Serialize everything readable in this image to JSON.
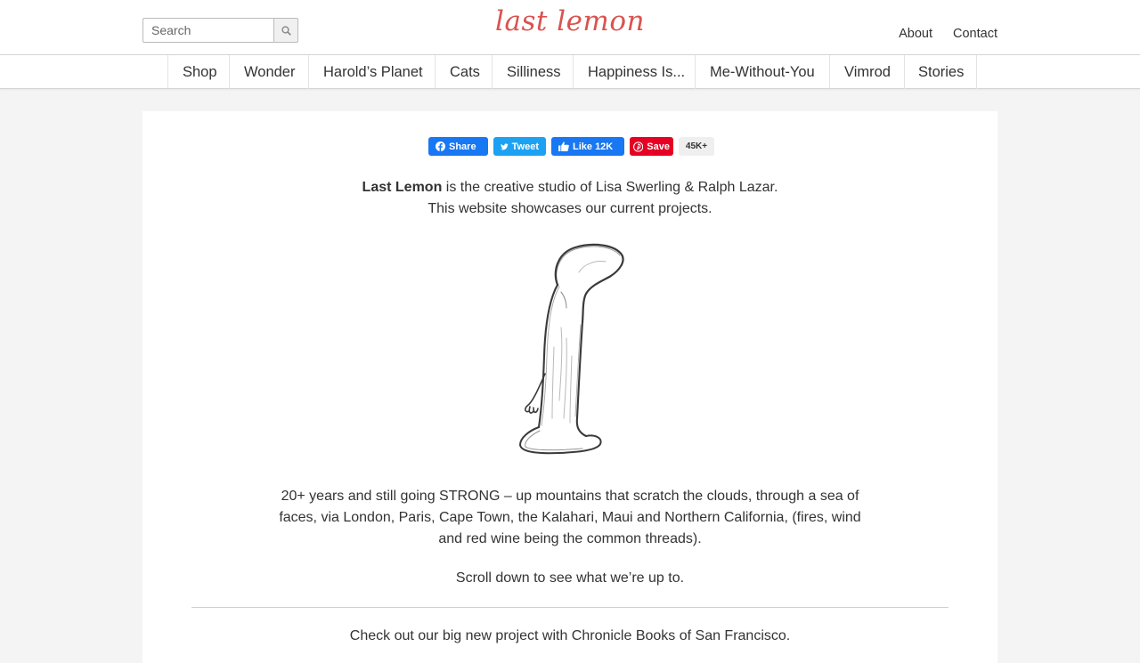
{
  "search": {
    "placeholder": "Search"
  },
  "logo": {
    "text": "last lemon"
  },
  "toplinks": [
    "About",
    "Contact"
  ],
  "nav": [
    "Shop",
    "Wonder",
    "Harold’s Planet",
    "Cats",
    "Silliness",
    "Happiness Is...",
    "Me-Without-You",
    "Vimrod",
    "Stories"
  ],
  "share": {
    "facebook": "Share",
    "twitter": "Tweet",
    "like": "Like 12K",
    "pinterest": "Save",
    "count": "45K+"
  },
  "intro": {
    "brand": "Last Lemon",
    "line1_rest": " is the creative studio of Lisa Swerling & Ralph Lazar.",
    "line2": "This website showcases our current projects."
  },
  "body": {
    "paragraph": "20+ years and still going STRONG – up mountains that scratch the clouds, through a sea of faces, via London, Paris, Cape Town, the Kalahari, Maui and Northern California, (fires, wind and red wine being the common threads).",
    "scroll": "Scroll down to see what we’re up to.",
    "promo": "Check out our big new project with Chronicle Books of San Francisco."
  },
  "colors": {
    "logo": "#d9534f",
    "facebook": "#1877f2",
    "twitter": "#1da1f2",
    "pinterest": "#e60023"
  }
}
